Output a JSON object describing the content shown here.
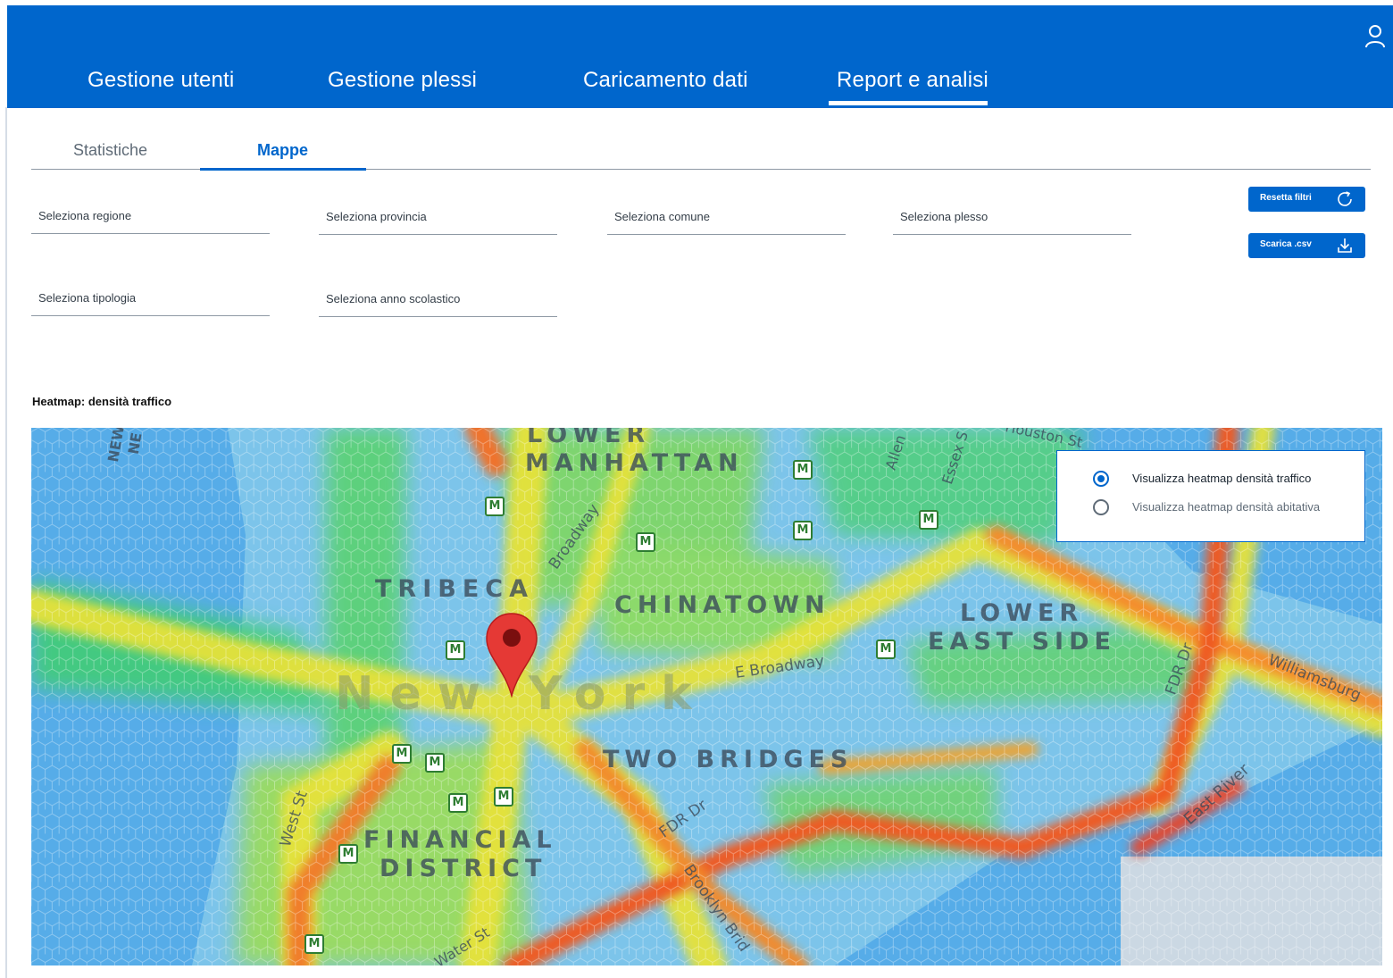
{
  "header": {
    "nav": [
      {
        "label": "Gestione utenti"
      },
      {
        "label": "Gestione plessi"
      },
      {
        "label": "Caricamento dati"
      },
      {
        "label": "Report e analisi"
      }
    ],
    "active_nav": "Report e analisi",
    "user_icon": "user-icon",
    "color": "#0066cc"
  },
  "subtabs": {
    "items": [
      {
        "label": "Statistiche"
      },
      {
        "label": "Mappe"
      }
    ],
    "active": "Mappe"
  },
  "filters": {
    "regione": "Seleziona regione",
    "provincia": "Seleziona provincia",
    "comune": "Seleziona comune",
    "plesso": "Seleziona plesso",
    "tipologia": "Seleziona tipologia",
    "anno": "Seleziona anno scolastico"
  },
  "actions": {
    "reset_label": "Resetta filtri",
    "reset_icon": "refresh-icon",
    "download_label": "Scarica .csv",
    "download_icon": "download-icon"
  },
  "map": {
    "title": "Heatmap: densità traffico",
    "labels": {
      "lower_manhattan_1": "LOWER",
      "lower_manhattan_2": "MANHATTAN",
      "tribeca": "TRIBECA",
      "chinatown": "CHINATOWN",
      "lower_east_side_1": "LOWER",
      "lower_east_side_2": "EAST SIDE",
      "new_york": "New York",
      "two_bridges": "TWO BRIDGES",
      "financial_1": "FINANCIAL",
      "financial_2": "DISTRICT",
      "broadway": "Broadway",
      "e_broadway": "E Broadway",
      "west_st": "West St",
      "fdr_dr": "FDR Dr",
      "fdr_dr_2": "FDR Dr",
      "brooklyn_bridge": "Brooklyn Brid",
      "east_river": "East River",
      "williamsburg": "Williamsburg",
      "water_st": "Water St",
      "allen": "Allen",
      "essex": "Essex S",
      "houston": "Houston St",
      "new_1": "NEW",
      "new_2": "NE"
    },
    "metro_letter": "M",
    "pin_color": "#e53935",
    "options": [
      {
        "label": "Visualizza heatmap densità traffico",
        "checked": true
      },
      {
        "label": "Visualizza heatmap densità abitativa",
        "checked": false
      }
    ]
  }
}
